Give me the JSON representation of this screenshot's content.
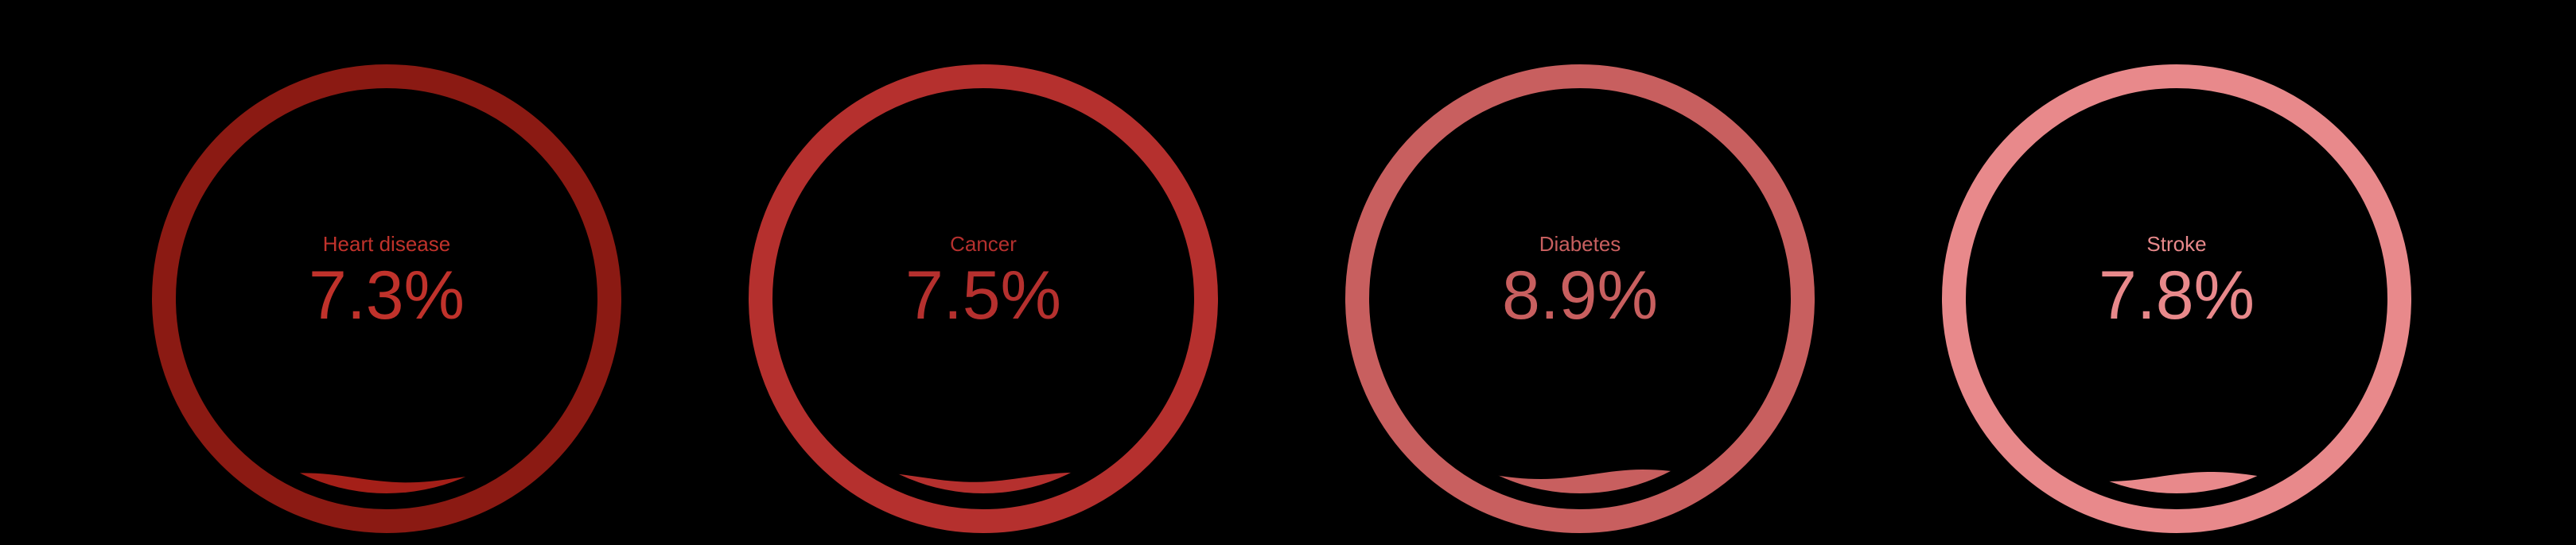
{
  "chart_data": {
    "type": "liquid-gauge",
    "min": 0,
    "max": 100,
    "gauges": [
      {
        "label": "Heart disease",
        "value": 7.3,
        "value_text": "7.3%",
        "color": "#8b1a13",
        "fill_color": "#a41f18",
        "text_color": "#c0322b"
      },
      {
        "label": "Cancer",
        "value": 7.5,
        "value_text": "7.5%",
        "color": "#b5302e",
        "fill_color": "#b5302e",
        "text_color": "#b5302e"
      },
      {
        "label": "Diabetes",
        "value": 8.9,
        "value_text": "8.9%",
        "color": "#c85f5f",
        "fill_color": "#c85f5f",
        "text_color": "#c85f5f"
      },
      {
        "label": "Stroke",
        "value": 7.8,
        "value_text": "7.8%",
        "color": "#e8898b",
        "fill_color": "#e8898b",
        "text_color": "#e8898b"
      }
    ]
  }
}
